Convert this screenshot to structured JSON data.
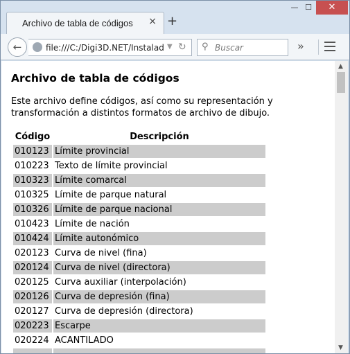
{
  "browser": {
    "tab_title": "Archivo de tabla de códigos",
    "tab_close": "×",
    "new_tab": "+",
    "url": "file:///C:/Digi3D.NET/Instalador",
    "search_placeholder": "Buscar",
    "window_controls": {
      "minimize": "—",
      "maximize": "☐",
      "close": "✕"
    }
  },
  "page": {
    "title": "Archivo de tabla de códigos",
    "intro": "Este archivo define códigos, así como su representación y transformación a distintos formatos de archivo de dibujo.",
    "table": {
      "headers": {
        "code": "Código",
        "description": "Descripción"
      },
      "rows": [
        {
          "code": "010123",
          "description": "Límite provincial",
          "shaded": true
        },
        {
          "code": "010223",
          "description": "Texto de límite provincial",
          "shaded": false
        },
        {
          "code": "010323",
          "description": "Límite comarcal",
          "shaded": true
        },
        {
          "code": "010325",
          "description": "Límite de parque natural",
          "shaded": false
        },
        {
          "code": "010326",
          "description": "Límite de parque nacional",
          "shaded": true
        },
        {
          "code": "010423",
          "description": "Límite de nación",
          "shaded": false
        },
        {
          "code": "010424",
          "description": "Límite autonómico",
          "shaded": true
        },
        {
          "code": "020123",
          "description": "Curva de nivel (fina)",
          "shaded": false
        },
        {
          "code": "020124",
          "description": "Curva de nivel (directora)",
          "shaded": true
        },
        {
          "code": "020125",
          "description": "Curva auxiliar (interpolación)",
          "shaded": false
        },
        {
          "code": "020126",
          "description": "Curva de depresión (fina)",
          "shaded": true
        },
        {
          "code": "020127",
          "description": "Curva de depresión (directora)",
          "shaded": false
        },
        {
          "code": "020223",
          "description": "Escarpe",
          "shaded": true
        },
        {
          "code": "020224",
          "description": "ACANTILADO",
          "shaded": false
        },
        {
          "code": "",
          "description": "",
          "shaded": true
        }
      ]
    }
  },
  "colors": {
    "row_shade": "#cccccc",
    "window_close": "#c75050"
  }
}
